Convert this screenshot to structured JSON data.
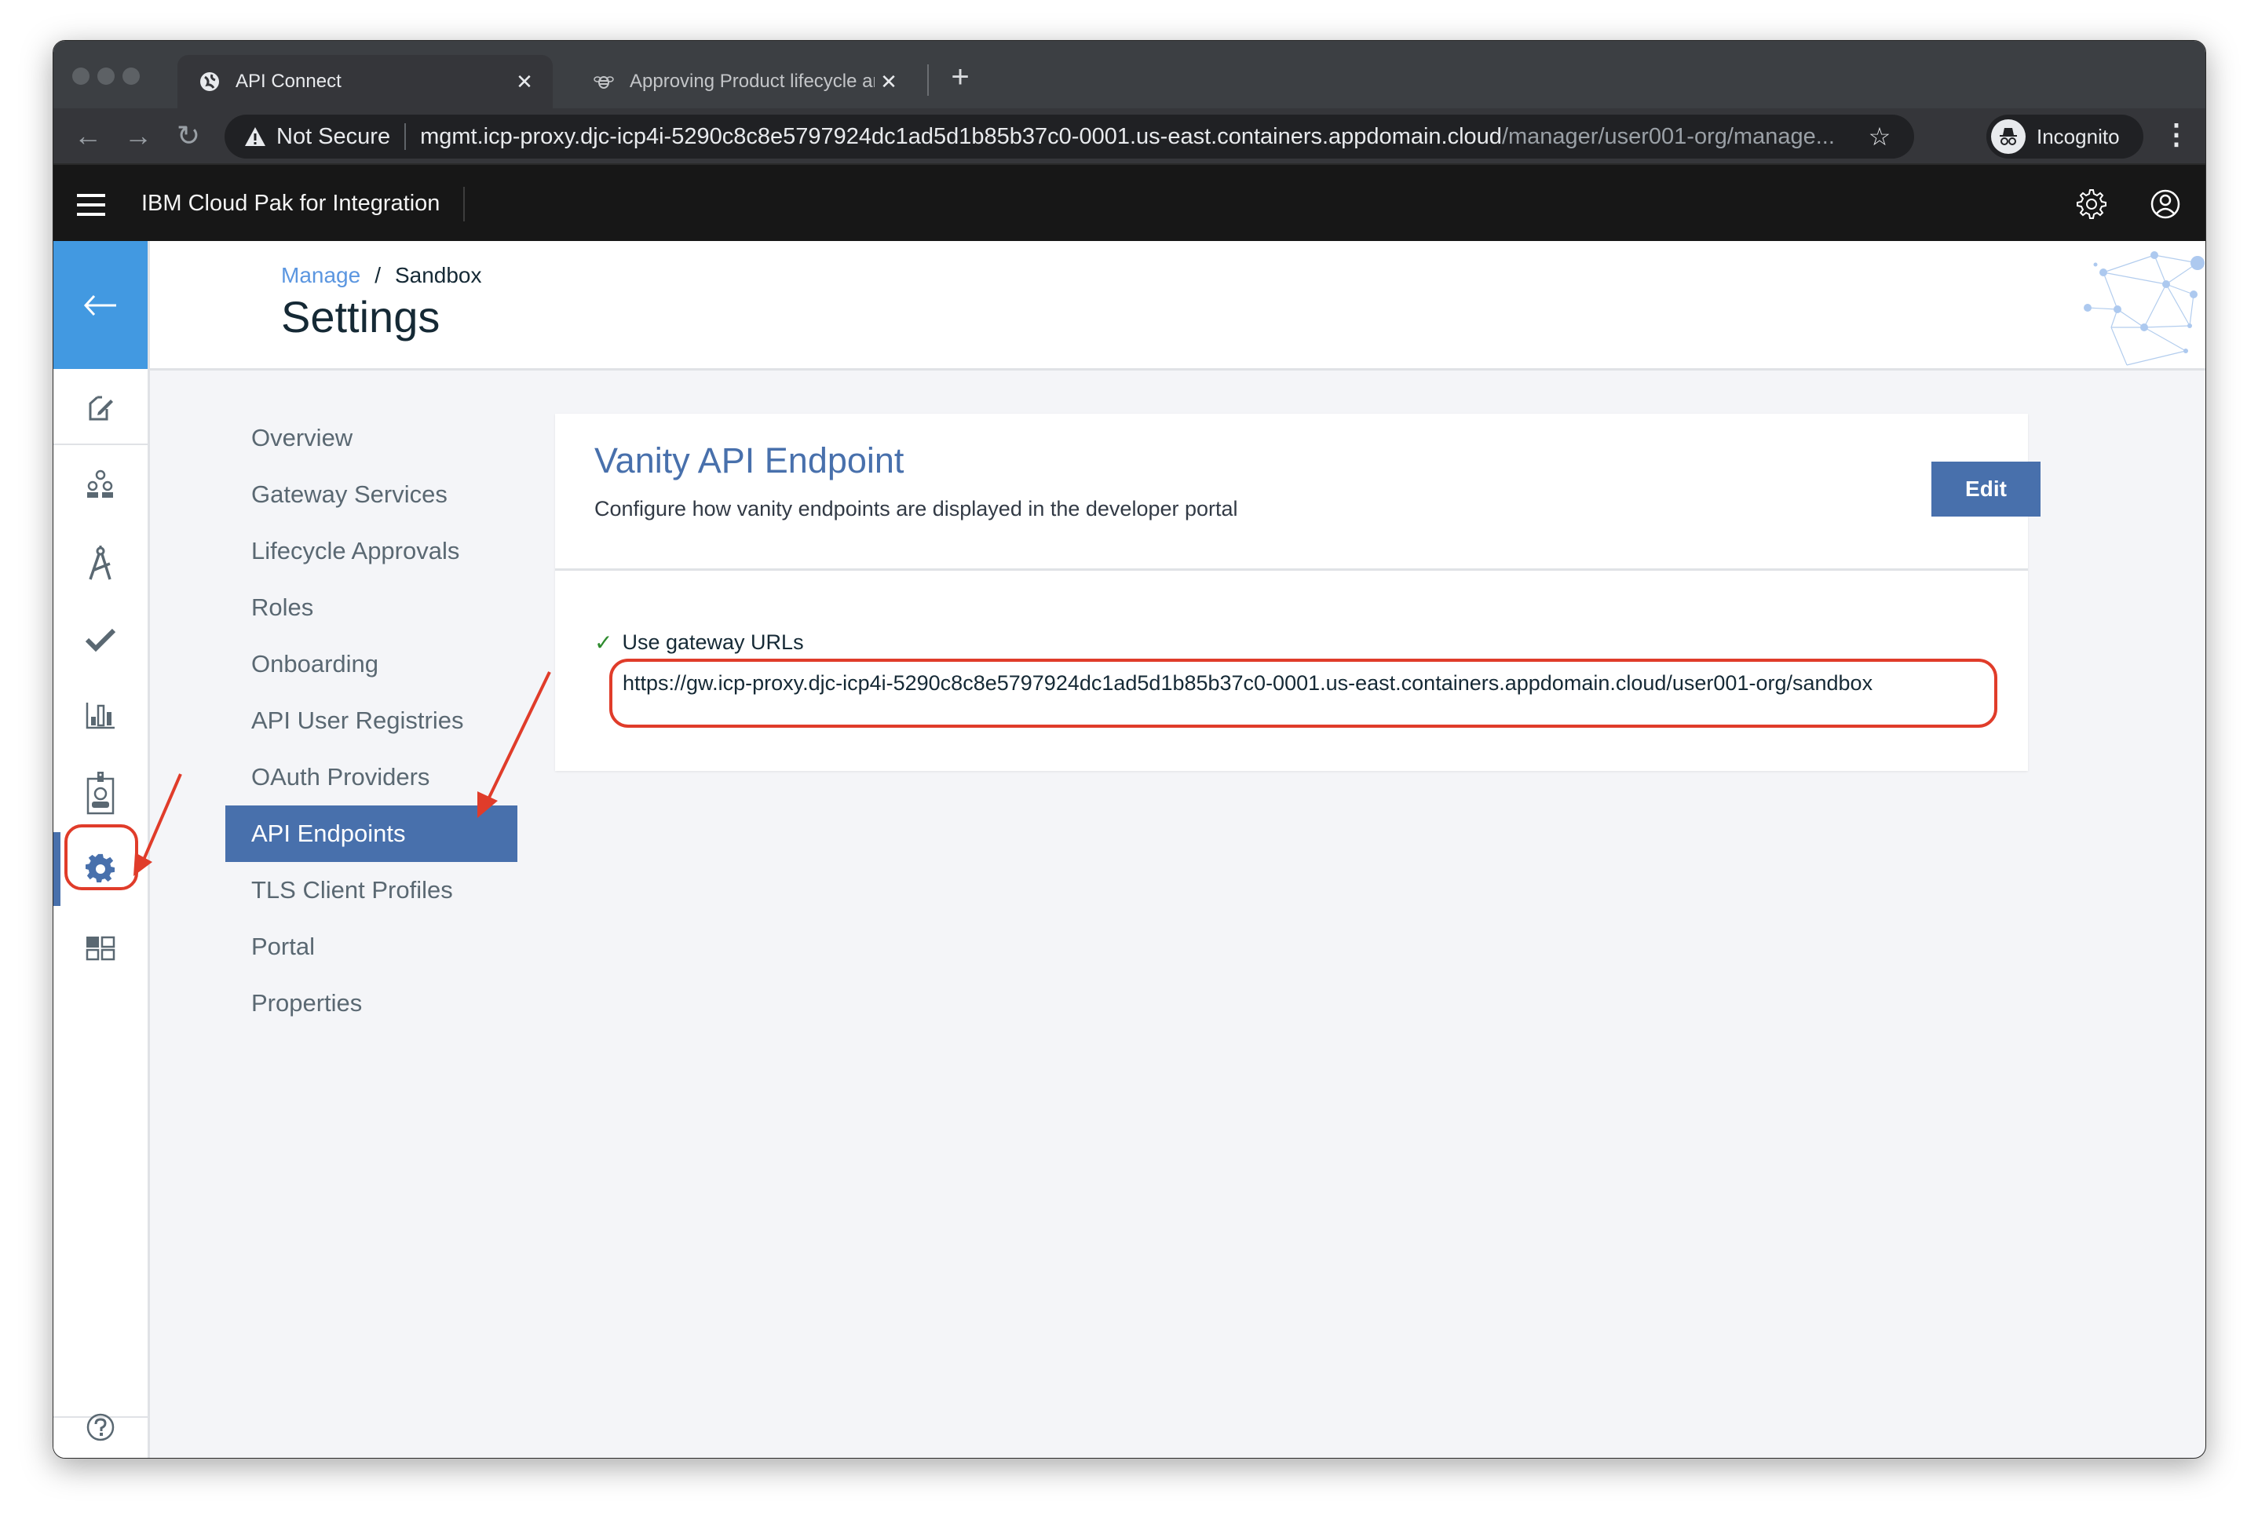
{
  "browser": {
    "tabs": [
      {
        "title": "API Connect",
        "icon": "globe-icon",
        "active": true
      },
      {
        "title": "Approving Product lifecycle an",
        "icon": "bee-icon",
        "active": false
      }
    ],
    "new_tab_label": "+",
    "security_label": "Not Secure",
    "url_host": "mgmt.icp-proxy.djc-icp4i-5290c8c8e5797924dc1ad5d1b85b37c0-0001.us-east.containers.appdomain.cloud",
    "url_path": "/manager/user001-org/manage...",
    "profile_label": "Incognito"
  },
  "app": {
    "brand": "IBM Cloud Pak for Integration"
  },
  "sidebar": {
    "items": [
      {
        "name": "develop",
        "icon": "edit-document-icon"
      },
      {
        "name": "manage",
        "icon": "users-icon"
      },
      {
        "name": "test",
        "icon": "compass-drafting-icon"
      },
      {
        "name": "approvals",
        "icon": "checkmark-icon"
      },
      {
        "name": "analytics",
        "icon": "bar-chart-icon"
      },
      {
        "name": "members",
        "icon": "badge-icon"
      },
      {
        "name": "settings",
        "icon": "gear-icon",
        "active": true
      },
      {
        "name": "dashboard",
        "icon": "dashboard-icon"
      }
    ],
    "help_icon": "help-icon"
  },
  "header": {
    "breadcrumb": {
      "link": "Manage",
      "separator": "/",
      "current": "Sandbox"
    },
    "title": "Settings"
  },
  "settings_nav": {
    "items": [
      {
        "label": "Overview"
      },
      {
        "label": "Gateway Services"
      },
      {
        "label": "Lifecycle Approvals"
      },
      {
        "label": "Roles"
      },
      {
        "label": "Onboarding"
      },
      {
        "label": "API User Registries"
      },
      {
        "label": "OAuth Providers"
      },
      {
        "label": "API Endpoints",
        "active": true
      },
      {
        "label": "TLS Client Profiles"
      },
      {
        "label": "Portal"
      },
      {
        "label": "Properties"
      }
    ]
  },
  "card": {
    "title": "Vanity API Endpoint",
    "subtitle": "Configure how vanity endpoints are displayed in the developer portal",
    "edit_label": "Edit",
    "option_label": "Use gateway URLs",
    "option_checked": true,
    "gateway_url": "https://gw.icp-proxy.djc-icp4i-5290c8c8e5797924dc1ad5d1b85b37c0-0001.us-east.containers.appdomain.cloud/user001-org/sandbox"
  },
  "colors": {
    "accent": "#4870ac",
    "back_button": "#4299e1",
    "annotation": "#e03c2a",
    "link": "#5b96e0"
  }
}
